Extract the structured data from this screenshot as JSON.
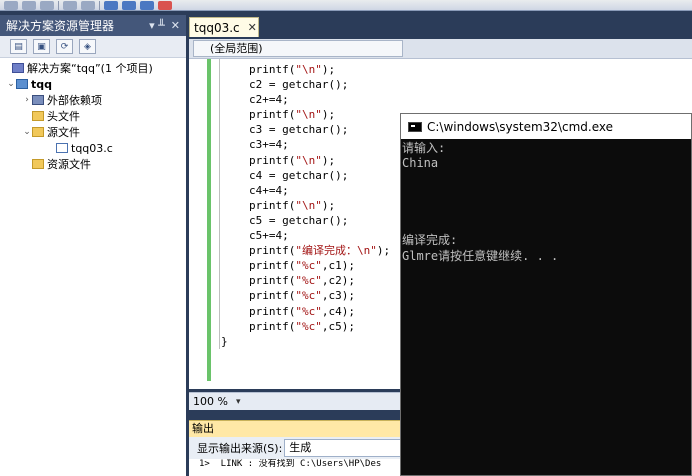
{
  "solution_explorer": {
    "title": "解决方案资源管理器",
    "pin": "▾ ╨",
    "close": "✕",
    "solution_label": "解决方案“tqq”(1 个项目)",
    "project": "tqq",
    "items": [
      {
        "label": "外部依赖项",
        "icon": "dependencies-icon"
      },
      {
        "label": "头文件",
        "icon": "folder-icon"
      },
      {
        "label": "源文件",
        "icon": "folder-open-icon"
      },
      {
        "label": "tqq03.c",
        "icon": "c-file-icon"
      },
      {
        "label": "资源文件",
        "icon": "folder-icon"
      }
    ]
  },
  "editor": {
    "tab_label": "tqq03.c",
    "tab_close": "✕",
    "scope": "(全局范围)",
    "zoom": "100 %",
    "code_lines": [
      {
        "t": "printf(",
        "s": "\"\\n\"",
        "e": ");"
      },
      {
        "t": "c2 = getchar();"
      },
      {
        "t": "c2+=4;"
      },
      {
        "t": "printf(",
        "s": "\"\\n\"",
        "e": ");"
      },
      {
        "t": "c3 = getchar();"
      },
      {
        "t": "c3+=4;"
      },
      {
        "t": "printf(",
        "s": "\"\\n\"",
        "e": ");"
      },
      {
        "t": "c4 = getchar();"
      },
      {
        "t": "c4+=4;"
      },
      {
        "t": "printf(",
        "s": "\"\\n\"",
        "e": ");"
      },
      {
        "t": "c5 = getchar();"
      },
      {
        "t": "c5+=4;"
      },
      {
        "t": "printf(",
        "s": "\"编译完成：\\n\"",
        "e": ");"
      },
      {
        "t": "printf(",
        "s": "\"%c\"",
        "e": ",c1);"
      },
      {
        "t": "printf(",
        "s": "\"%c\"",
        "e": ",c2);"
      },
      {
        "t": "printf(",
        "s": "\"%c\"",
        "e": ",c3);"
      },
      {
        "t": "printf(",
        "s": "\"%c\"",
        "e": ",c4);"
      },
      {
        "t": "printf(",
        "s": "\"%c\"",
        "e": ",c5);"
      }
    ],
    "closing_brace": "}"
  },
  "output": {
    "title": "输出",
    "source_label": "显示输出来源(S):",
    "source_value": "生成",
    "line": "1>  LINK : 没有找到 C:\\Users\\HP\\Des"
  },
  "cmd": {
    "title": "C:\\windows\\system32\\cmd.exe",
    "lines": [
      "请输入:",
      "China",
      "",
      "",
      "",
      "",
      "编译完成:",
      "Glmre请按任意键继续. . ."
    ]
  }
}
